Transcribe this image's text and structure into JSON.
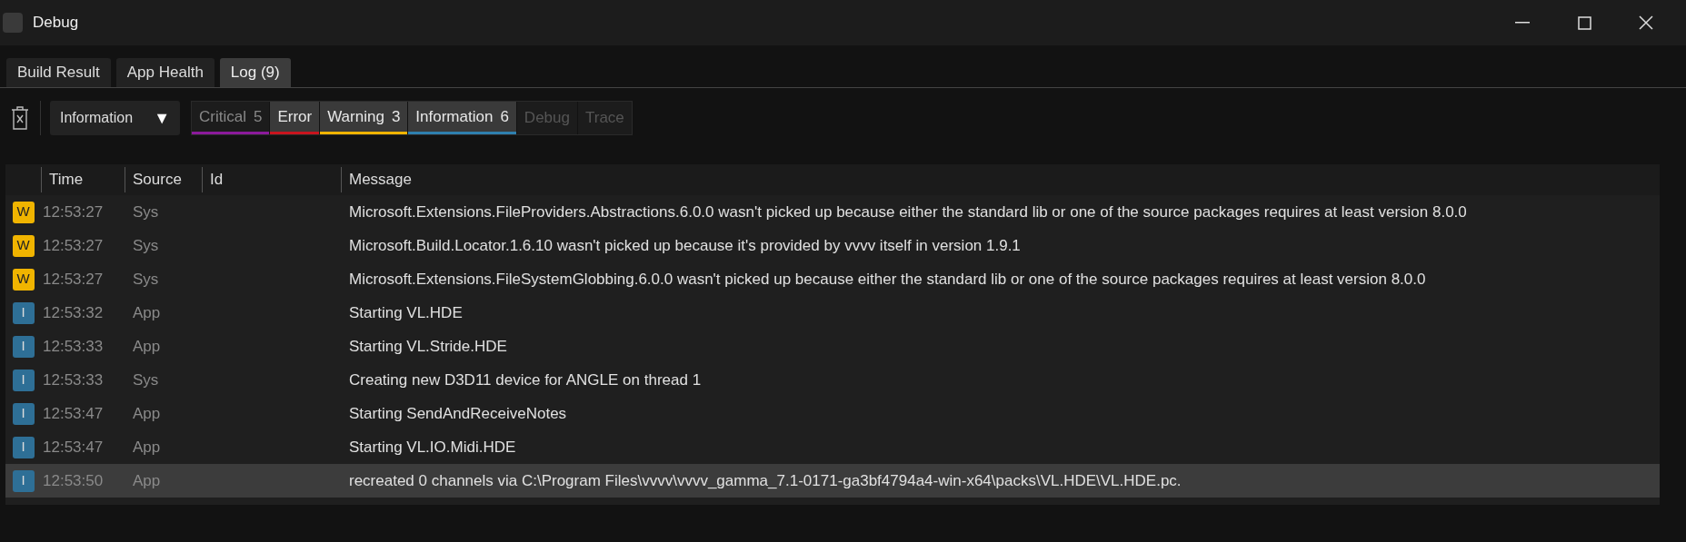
{
  "window": {
    "title": "Debug"
  },
  "tabs": [
    {
      "label": "Build Result",
      "selected": false
    },
    {
      "label": "App Health",
      "selected": false
    },
    {
      "label": "Log (9)",
      "selected": true
    }
  ],
  "level_dropdown": {
    "value": "Information",
    "caret": "▼"
  },
  "filters": [
    {
      "label": "Critical",
      "count": "5",
      "color": "#8b1a9b",
      "selected": false,
      "disabled": false
    },
    {
      "label": "Error",
      "color": "#c8141e",
      "selected": true,
      "disabled": false
    },
    {
      "label": "Warning",
      "count": "3",
      "color": "#f0b400",
      "selected": true,
      "disabled": false
    },
    {
      "label": "Information",
      "count": "6",
      "color": "#2f7fae",
      "selected": true,
      "disabled": false
    },
    {
      "label": "Debug",
      "selected": false,
      "disabled": true
    },
    {
      "label": "Trace",
      "selected": false,
      "disabled": true
    }
  ],
  "table": {
    "columns": [
      "Time",
      "Source",
      "Id",
      "Message"
    ],
    "rows": [
      {
        "kind": "warning",
        "badge": "W",
        "time": "12:53:27",
        "source": "Sys",
        "message": "Microsoft.Extensions.FileProviders.Abstractions.6.0.0 wasn't picked up because either the standard lib or one of the source packages requires at least version 8.0.0",
        "selected": false
      },
      {
        "kind": "warning",
        "badge": "W",
        "time": "12:53:27",
        "source": "Sys",
        "message": "Microsoft.Build.Locator.1.6.10 wasn't picked up because it's provided by vvvv itself in version 1.9.1",
        "selected": false
      },
      {
        "kind": "warning",
        "badge": "W",
        "time": "12:53:27",
        "source": "Sys",
        "message": "Microsoft.Extensions.FileSystemGlobbing.6.0.0 wasn't picked up because either the standard lib or one of the source packages requires at least version 8.0.0",
        "selected": false
      },
      {
        "kind": "info",
        "badge": "I",
        "time": "12:53:32",
        "source": "App",
        "message": "Starting VL.HDE",
        "selected": false
      },
      {
        "kind": "info",
        "badge": "I",
        "time": "12:53:33",
        "source": "App",
        "message": "Starting VL.Stride.HDE",
        "selected": false
      },
      {
        "kind": "info",
        "badge": "I",
        "time": "12:53:33",
        "source": "Sys",
        "message": "Creating new D3D11 device for ANGLE on thread 1",
        "selected": false
      },
      {
        "kind": "info",
        "badge": "I",
        "time": "12:53:47",
        "source": "App",
        "message": "Starting SendAndReceiveNotes",
        "selected": false
      },
      {
        "kind": "info",
        "badge": "I",
        "time": "12:53:47",
        "source": "App",
        "message": "Starting VL.IO.Midi.HDE",
        "selected": false
      },
      {
        "kind": "info",
        "badge": "I",
        "time": "12:53:50",
        "source": "App",
        "message": "recreated 0 channels via C:\\Program Files\\vvvv\\vvvv_gamma_7.1-0171-ga3bf4794a4-win-x64\\packs\\VL.HDE\\VL.HDE.pc.",
        "selected": true
      }
    ]
  }
}
